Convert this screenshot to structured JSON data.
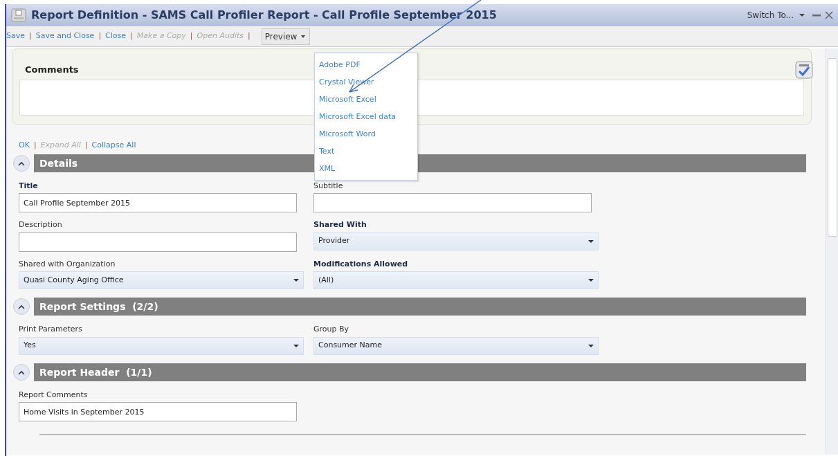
{
  "window": {
    "title": "Report Definition - SAMS Call Profiler Report - Call Profile September 2015",
    "switch_to": "Switch To..."
  },
  "toolbar": [
    {
      "label": "Save",
      "disabled": false,
      "separator": "|"
    },
    {
      "label": "Save and Close",
      "disabled": false,
      "separator": "|"
    },
    {
      "label": "Close",
      "disabled": false,
      "separator": "|"
    },
    {
      "label": "Make a Copy",
      "disabled": true,
      "separator": "|"
    },
    {
      "label": "Open Audits",
      "disabled": true,
      "separator": "|"
    }
  ],
  "preview": {
    "label": "Preview",
    "expanded": true,
    "options": [
      "Adobe PDF",
      "Crystal Viewer",
      "Microsoft Excel",
      "Microsoft Excel data",
      "Microsoft Word",
      "Text",
      "XML"
    ]
  },
  "comments": {
    "title": "Comments"
  },
  "section_links": [
    {
      "label": "OK",
      "disabled": false,
      "separator": "|"
    },
    {
      "label": "Expand All",
      "disabled": true,
      "separator": "|"
    },
    {
      "label": "Collapse All",
      "disabled": false
    }
  ],
  "sections": [
    {
      "title": "Details",
      "expanded": true,
      "fields": [
        {
          "label": "Title",
          "kind": "text",
          "value": "Call Profile September 2015",
          "required": true
        },
        {
          "label": "Subtitle",
          "kind": "text",
          "required": false
        },
        {
          "label": "Description",
          "kind": "text",
          "required": false
        },
        {
          "label": "Shared With",
          "kind": "select",
          "value": "Provider",
          "required": true
        },
        {
          "label": "Shared with Organization",
          "kind": "select",
          "value": "Quasi County Aging Office",
          "required": false
        },
        {
          "label": "Modifications Allowed",
          "kind": "select",
          "value": "(All)",
          "required": true
        }
      ]
    },
    {
      "title": "Report Settings  (2/2)",
      "expanded": true,
      "fields": [
        {
          "label": "Print Parameters",
          "kind": "select",
          "value": "Yes",
          "required": false
        },
        {
          "label": "Group By",
          "kind": "select",
          "value": "Consumer Name",
          "required": false
        }
      ]
    },
    {
      "title": "Report Header  (1/1)",
      "expanded": true,
      "fields": [
        {
          "label": "Report Comments",
          "kind": "text",
          "value": "Home Visits in September 2015",
          "required": false
        }
      ]
    }
  ]
}
